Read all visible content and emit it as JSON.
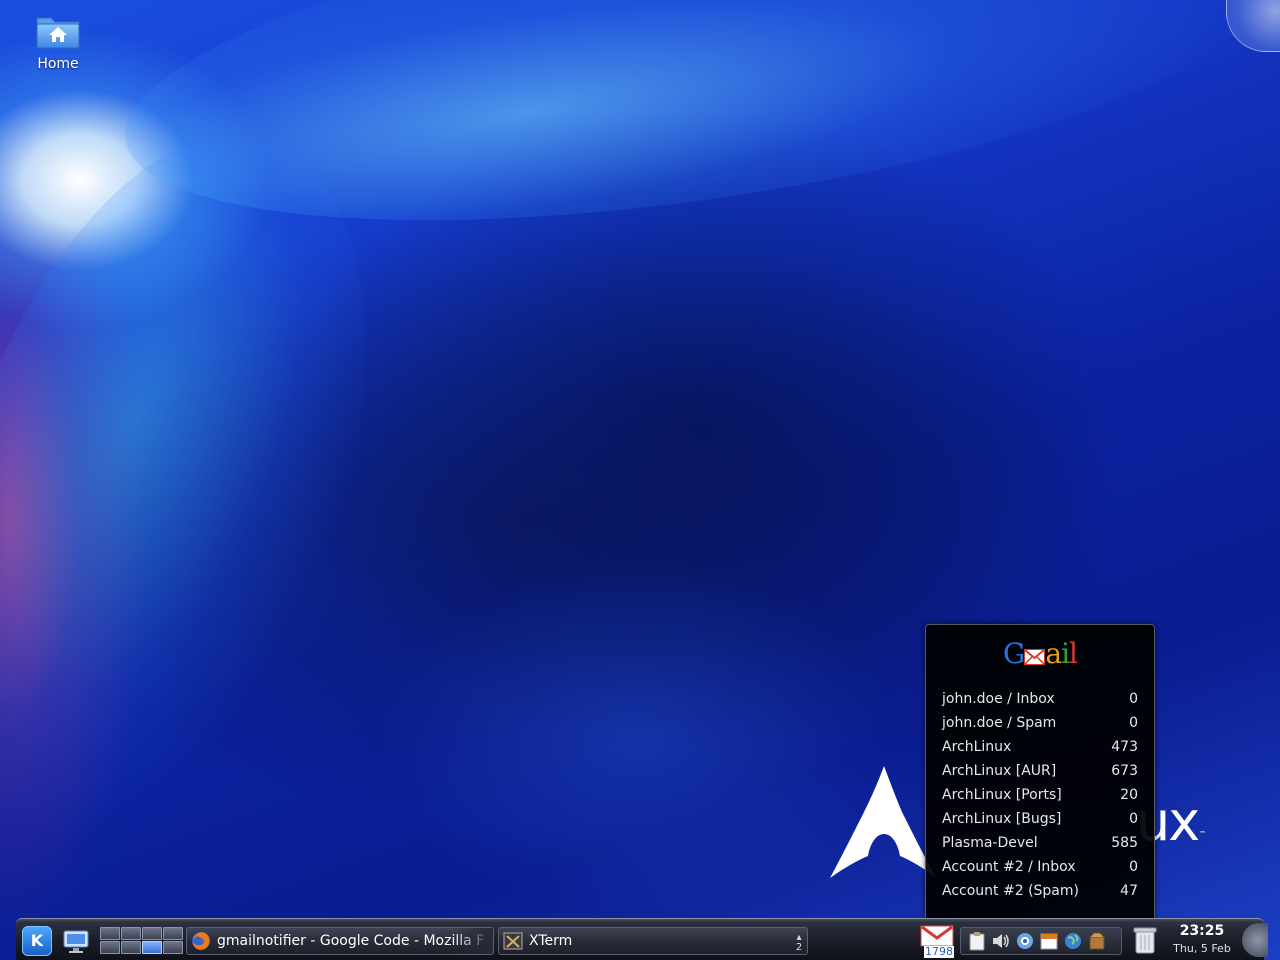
{
  "desktop": {
    "icons": [
      {
        "label": "Home",
        "icon": "home-folder-icon"
      }
    ],
    "wallpaper_logo_text": "ux",
    "wallpaper_logo_tm": "™"
  },
  "gmail_popup": {
    "logo_text": {
      "g": "G",
      "a": "a",
      "i": "i",
      "l": "l"
    },
    "accounts": [
      {
        "name": "john.doe / Inbox",
        "count": "0"
      },
      {
        "name": "john.doe / Spam",
        "count": "0"
      },
      {
        "name": "ArchLinux",
        "count": "473"
      },
      {
        "name": "ArchLinux [AUR]",
        "count": "673"
      },
      {
        "name": "ArchLinux [Ports]",
        "count": "20"
      },
      {
        "name": "ArchLinux [Bugs]",
        "count": "0"
      },
      {
        "name": "Plasma-Devel",
        "count": "585"
      },
      {
        "name": "Account #2 / Inbox",
        "count": "0"
      },
      {
        "name": "Account #2 (Spam)",
        "count": "47"
      }
    ]
  },
  "panel": {
    "kmenu_letter": "K",
    "tasks": [
      {
        "label": "gmailnotifier - Google Code - Mozilla F",
        "icon": "firefox-icon"
      },
      {
        "label": "XTerm",
        "icon": "xterm-icon"
      }
    ],
    "desktop_count": "2",
    "gmail_tray_count": "1798",
    "tray_icons": [
      "clipboard-icon",
      "volume-icon",
      "network-icon",
      "calendar-icon",
      "globe-icon",
      "package-icon"
    ],
    "clock": {
      "time": "23:25",
      "date": "Thu, 5 Feb"
    }
  },
  "colors": {
    "panel_bg": "#1a1d27",
    "popup_bg": "#000000",
    "gmail_blue": "#2a74d8",
    "gmail_red": "#d53a2e",
    "gmail_yellow": "#e3a21a",
    "gmail_green": "#3a9d3a",
    "wallpaper_blue": "#1438c8"
  }
}
